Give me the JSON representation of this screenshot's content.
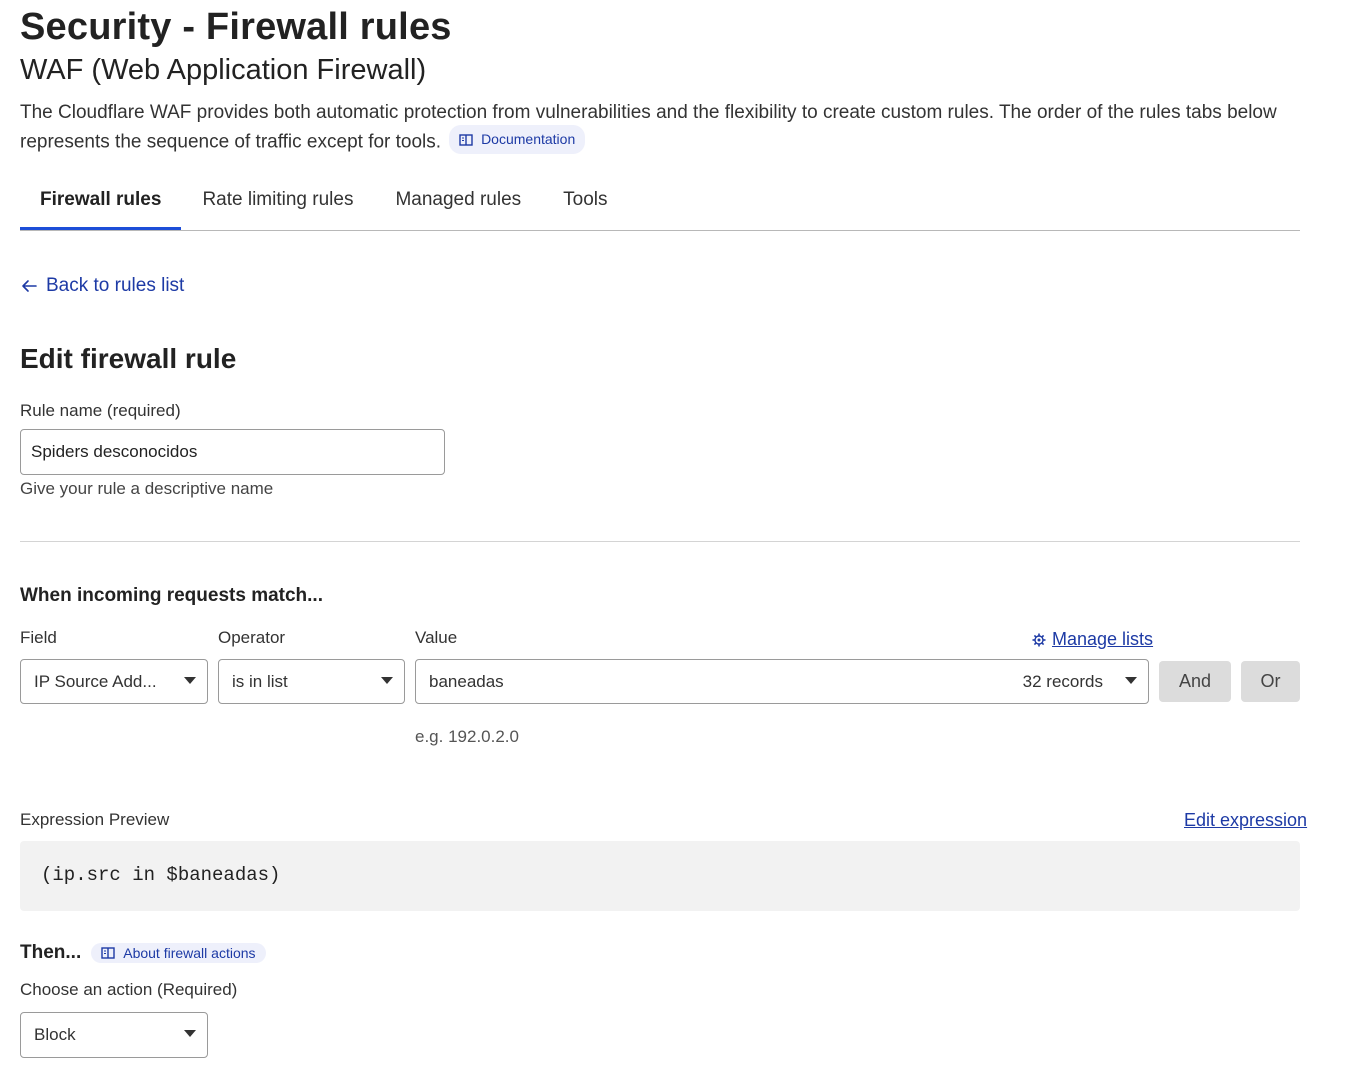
{
  "header": {
    "title": "Security - Firewall rules",
    "subtitle": "WAF (Web Application Firewall)",
    "description": "The Cloudflare WAF provides both automatic protection from vulnerabilities and the flexibility to create custom rules. The order of the rules tabs below represents the sequence of traffic except for tools.",
    "doc_link": {
      "label": "Documentation",
      "icon": "book-icon"
    }
  },
  "tabs": [
    {
      "label": "Firewall rules",
      "active": true
    },
    {
      "label": "Rate limiting rules",
      "active": false
    },
    {
      "label": "Managed rules",
      "active": false
    },
    {
      "label": "Tools",
      "active": false
    }
  ],
  "back_link": {
    "label": "Back to rules list",
    "icon": "arrow-left-icon"
  },
  "form": {
    "title": "Edit firewall rule",
    "rule_name": {
      "label": "Rule name (required)",
      "value": "Spiders desconocidos",
      "hint": "Give your rule a descriptive name"
    },
    "match": {
      "heading": "When incoming requests match...",
      "field_label": "Field",
      "operator_label": "Operator",
      "value_label": "Value",
      "manage_lists": {
        "label": "Manage lists",
        "icon": "gear-icon"
      },
      "field_value": "IP Source Add...",
      "operator_value": "is in list",
      "value_value": "baneadas",
      "value_count": "32 records",
      "and_label": "And",
      "or_label": "Or",
      "value_hint": "e.g. 192.0.2.0"
    },
    "expression": {
      "label": "Expression Preview",
      "edit_label": "Edit expression",
      "code": "(ip.src in $baneadas)"
    },
    "then": {
      "heading": "Then...",
      "about_link": {
        "label": "About firewall actions",
        "icon": "book-icon"
      },
      "action_label": "Choose an action (Required)",
      "action_value": "Block"
    }
  },
  "colors": {
    "accent": "#1d4ed8",
    "link": "#1d3aa5",
    "pill_bg": "#eef0fb"
  }
}
